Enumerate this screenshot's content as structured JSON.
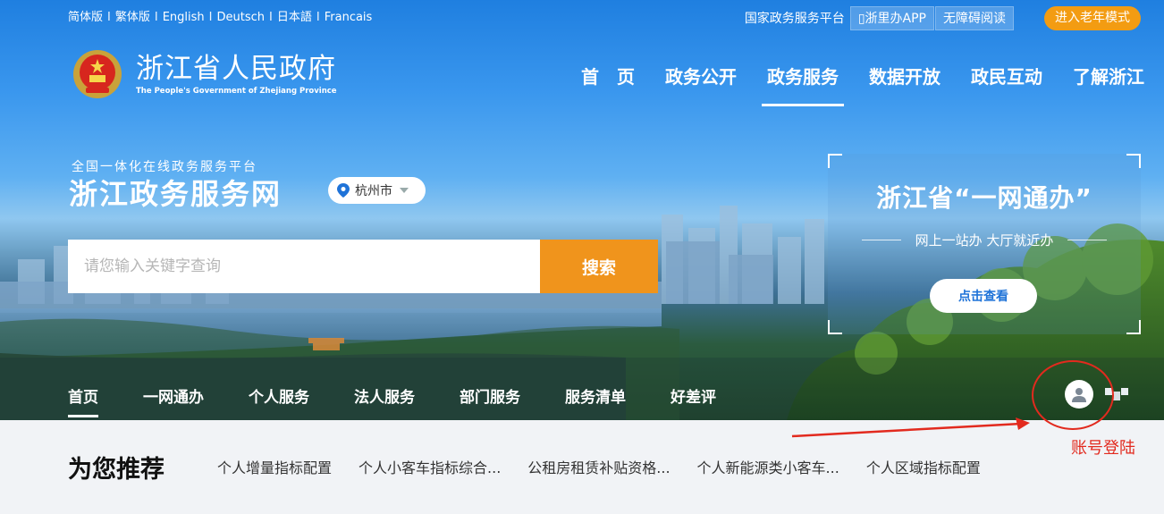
{
  "top_links": [
    "简体版",
    "繁体版",
    "English",
    "Deutsch",
    "日本語",
    "Francais"
  ],
  "top_right": {
    "gov_platform": "国家政务服务平台",
    "app": "浙里办APP",
    "accessible": "无障碍阅读",
    "elder_mode": "进入老年模式"
  },
  "logo": {
    "cn": "浙江省人民政府",
    "en": "The People's Government of Zhejiang Province"
  },
  "main_nav": [
    "首　页",
    "政务公开",
    "政务服务",
    "数据开放",
    "政民互动",
    "了解浙江"
  ],
  "main_nav_active": "政务服务",
  "platform": {
    "subtitle": "全国一体化在线政务服务平台",
    "title": "浙江政务服务网",
    "city": "杭州市"
  },
  "search": {
    "placeholder": "请您输入关键字查询",
    "button": "搜索"
  },
  "promo": {
    "title": "浙江省“一网通办”",
    "subtitle": "网上一站办 大厅就近办",
    "button": "点击查看"
  },
  "sub_nav": [
    "首页",
    "一网通办",
    "个人服务",
    "法人服务",
    "部门服务",
    "服务清单",
    "好差评"
  ],
  "annotation": {
    "label": "账号登陆"
  },
  "recommend": {
    "title": "为您推荐",
    "items": [
      "个人增量指标配置",
      "个人小客车指标综合...",
      "公租房租赁补贴资格...",
      "个人新能源类小客车...",
      "个人区域指标配置"
    ]
  },
  "colors": {
    "accent_orange": "#f0941c",
    "annotation_red": "#e22a1e",
    "link_blue": "#1f73d8"
  }
}
